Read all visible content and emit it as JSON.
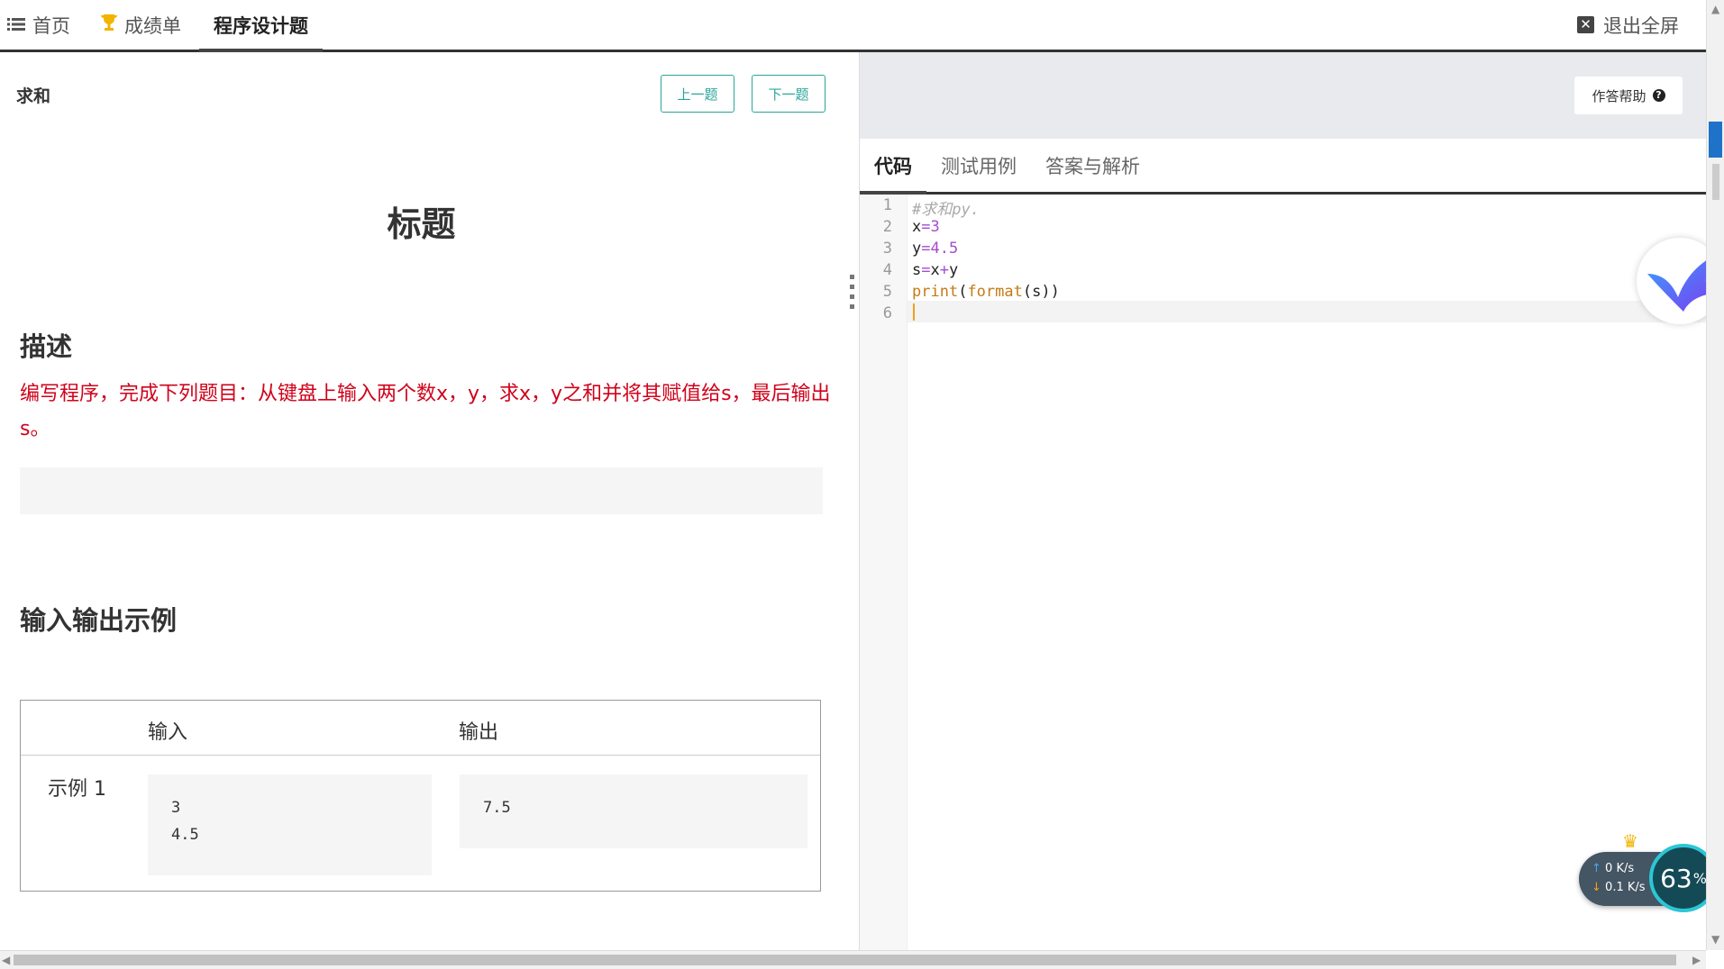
{
  "nav": {
    "tabs": [
      {
        "label": "首页",
        "icon": "list-icon"
      },
      {
        "label": "成绩单",
        "icon": "trophy-icon"
      },
      {
        "label": "程序设计题",
        "icon": ""
      }
    ],
    "active_tab": 2,
    "exit_fullscreen": "退出全屏"
  },
  "question": {
    "title": "求和",
    "prev_button": "上一题",
    "next_button": "下一题",
    "heading": "标题",
    "description_title": "描述",
    "description": "编写程序，完成下列题目：从键盘上输入两个数x，y，求x，y之和并将其赋值给s，最后输出s。",
    "io_title": "输入输出示例",
    "table": {
      "col_input": "输入",
      "col_output": "输出",
      "examples": [
        {
          "label": "示例 1",
          "input": [
            "3",
            "4.5"
          ],
          "output": [
            "7.5"
          ]
        }
      ]
    }
  },
  "editor": {
    "help_button": "作答帮助",
    "tabs": [
      "代码",
      "测试用例",
      "答案与解析"
    ],
    "active_tab": 0,
    "line_numbers": [
      "1",
      "2",
      "3",
      "4",
      "5",
      "6"
    ],
    "code": [
      "#求和py.",
      "x=3",
      "y=4.5",
      "s=x+y",
      "print(format(s))",
      ""
    ]
  },
  "net_monitor": {
    "upload": "0 K/s",
    "download": "0.1 K/s",
    "percent": "63",
    "percent_unit": "%"
  },
  "colors": {
    "accent": "#2aa59a",
    "description_red": "#d0021b",
    "tab_underline": "#444444"
  }
}
